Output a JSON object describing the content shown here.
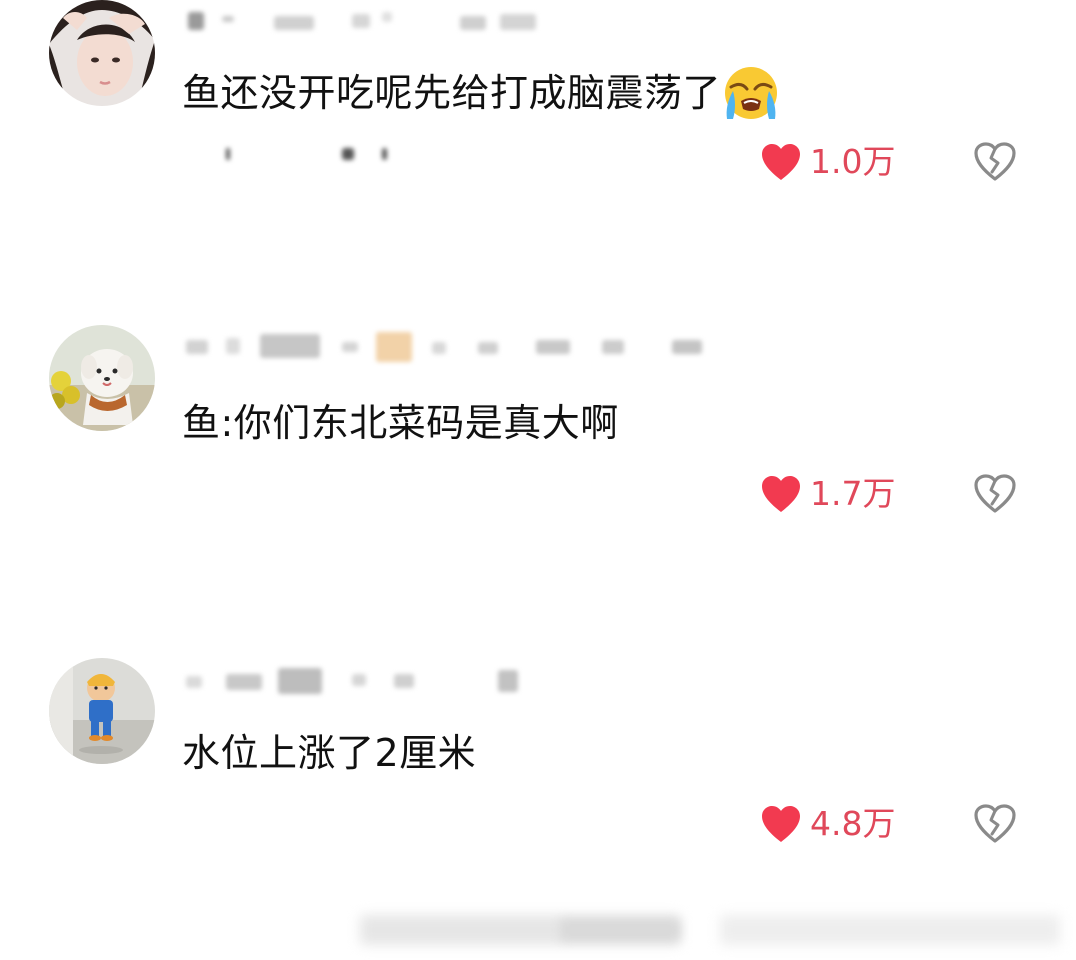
{
  "comments": [
    {
      "text": "鱼还没开吃呢先给打成脑震荡了",
      "emoji": "loudly-crying-face",
      "likes": "1.0万"
    },
    {
      "text": "鱼:你们东北菜码是真大啊",
      "likes": "1.7万"
    },
    {
      "text": "水位上涨了2厘米",
      "likes": "4.8万"
    }
  ],
  "colors": {
    "like_red": "#f23a50",
    "like_count": "#e0485a",
    "dislike_gray": "#8a8a8a"
  }
}
